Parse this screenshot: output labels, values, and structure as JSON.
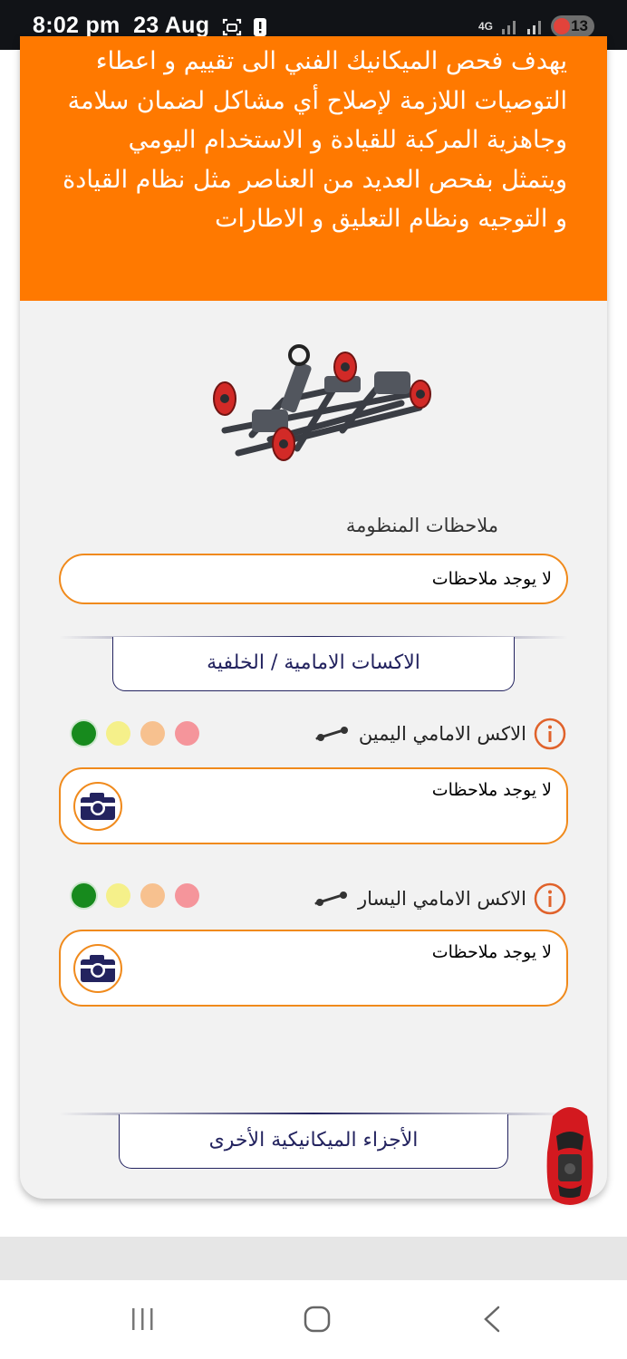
{
  "status_bar": {
    "time": "8:02 pm",
    "date": "23 Aug",
    "network_label": "4G",
    "battery_level": "13",
    "icons": [
      "screenshot-icon",
      "alert-icon",
      "signal-icon",
      "signal-icon",
      "battery-icon"
    ]
  },
  "intro": {
    "text": "يهدف فحص الميكانيك الفني الى تقييم و اعطاء التوصيات اللازمة لإصلاح أي مشاكل لضمان سلامة وجاهزية المركبة للقيادة و الاستخدام اليومي ويتمثل بفحص العديد من العناصر مثل نظام القيادة و التوجيه ونظام التعليق و الاطارات"
  },
  "system_notes": {
    "label": "ملاحظات المنظومة",
    "value": "لا يوجد ملاحظات"
  },
  "sections": {
    "axles": {
      "title": "الاكسات الامامية / الخلفية"
    },
    "other_parts": {
      "title": "الأجزاء الميكانيكية الأخرى"
    }
  },
  "items": [
    {
      "title": "الاكس الامامي اليمين",
      "note": "لا يوجد ملاحظات",
      "selected_rating": "green"
    },
    {
      "title": "الاكس الامامي اليسار",
      "note": "لا يوجد ملاحظات",
      "selected_rating": "green"
    }
  ],
  "colors": {
    "accent_orange": "#ff7900",
    "border_orange": "#f08a1c",
    "navy": "#23235f",
    "rating_red": "#f5959b",
    "rating_orange": "#f7c18f",
    "rating_yellow": "#f5f08a",
    "rating_green": "#178a1d"
  },
  "nav": {
    "icons": [
      "recent-apps-icon",
      "home-icon",
      "back-icon"
    ]
  }
}
